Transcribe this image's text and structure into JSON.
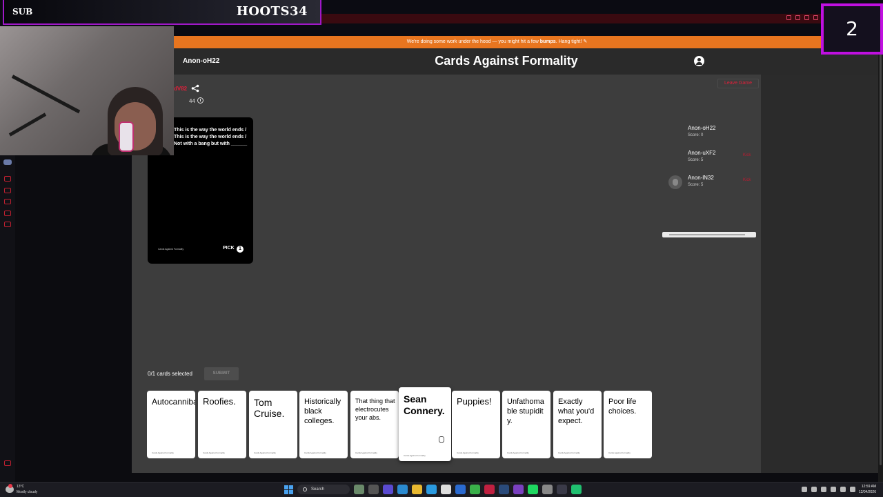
{
  "overlay": {
    "sub_label": "SUB",
    "streamer_name": "HOOTS34",
    "counter": "2"
  },
  "banner": {
    "text_pre": "We're doing some work under the hood — you might hit a few ",
    "text_bold": "bumps",
    "text_post": ". Hang tight! ✎"
  },
  "header": {
    "username": "Anon-oH22",
    "title": "Cards Against Formality"
  },
  "game": {
    "code": "dV82",
    "timer": "44",
    "leave_label": "Leave Game"
  },
  "black_card": {
    "prompt": "This is the way the world ends / This is the way the world ends / Not with a bang but with ______",
    "brand": "Cards Against Formality",
    "pick_label": "PICK",
    "pick_count": "1"
  },
  "players": [
    {
      "name": "Anon-oH22",
      "score": "Score: 0",
      "kick": ""
    },
    {
      "name": "Anon-uXF2",
      "score": "Score: 5",
      "kick": "Kick"
    },
    {
      "name": "Anon-lN32",
      "score": "Score: 5",
      "kick": "Kick"
    }
  ],
  "selection": {
    "status": "0/1 cards selected",
    "submit_label": "SUBMIT"
  },
  "hand": [
    {
      "text": "Autocannibalism."
    },
    {
      "text": "Roofies."
    },
    {
      "text": "Tom Cruise."
    },
    {
      "text": "Historically black colleges."
    },
    {
      "text": "That thing that electrocutes your abs."
    },
    {
      "text": "Sean Connery."
    },
    {
      "text": "Puppies!"
    },
    {
      "text": "Unfathomable stupidity."
    },
    {
      "text": "Exactly what you'd expect."
    },
    {
      "text": "Poor life choices."
    }
  ],
  "card_footer": "Cards Against Formality",
  "taskbar": {
    "weather_temp": "13°C",
    "weather_desc": "Mostly cloudy",
    "search_label": "Search",
    "time": "12:59 AM",
    "date": "12/04/2026"
  },
  "colors": {
    "accent_orange": "#e8751f",
    "kick_red": "#c01a30",
    "overlay_purple": "#a018c8"
  }
}
